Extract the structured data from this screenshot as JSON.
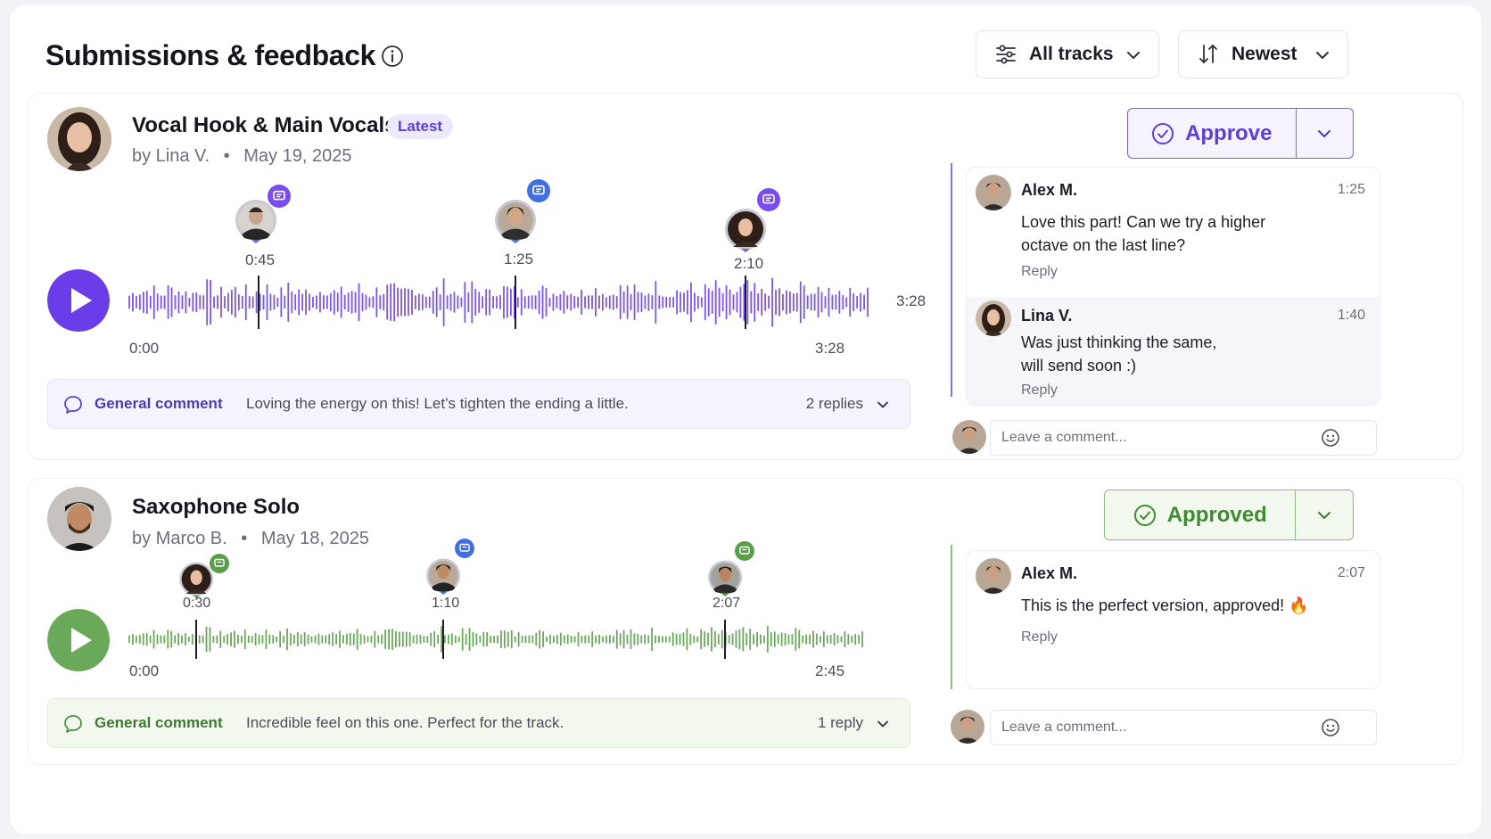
{
  "header": {
    "title": "Submissions & feedback",
    "filter_label": "All tracks",
    "sort_label": "Newest"
  },
  "colors": {
    "purple": "#6a3de8",
    "green": "#5a9e4b",
    "blue": "#3f6fe0"
  },
  "tracks": [
    {
      "title": "Vocal Hook & Main Vocals",
      "badge": "Latest",
      "artist": "by Lina V.",
      "date": "May 19, 2025",
      "start_time": "0:00",
      "end_time": "3:28",
      "duration": "3:28",
      "status_label": "Approve",
      "markers": [
        {
          "time": "0:45",
          "badge_color": "purple"
        },
        {
          "time": "1:25",
          "badge_color": "blue"
        },
        {
          "time": "2:10",
          "badge_color": "purple"
        }
      ],
      "general_comment": {
        "label": "General comment",
        "text": "Loving the energy on this! Let’s tighten the ending a little.",
        "replies": "2 replies"
      },
      "comments": [
        {
          "author": "Alex M.",
          "time": "1:25",
          "text": "Love this part! Can we try a higher octave on the last line?",
          "reply": "Reply"
        },
        {
          "author": "Lina V.",
          "time": "1:40",
          "text": "Was just thinking the same, will send soon :)",
          "reply": "Reply"
        }
      ],
      "input_placeholder": "Leave a comment..."
    },
    {
      "title": "Saxophone Solo",
      "artist": "by Marco B.",
      "date": "May 18, 2025",
      "start_time": "0:00",
      "end_time": "2:45",
      "status_label": "Approved",
      "markers": [
        {
          "time": "0:30",
          "badge_color": "green"
        },
        {
          "time": "1:10",
          "badge_color": "blue"
        },
        {
          "time": "2:07",
          "badge_color": "green"
        }
      ],
      "general_comment": {
        "label": "General comment",
        "text": "Incredible feel on this one. Perfect for the track.",
        "replies": "1 reply"
      },
      "comments": [
        {
          "author": "Alex M.",
          "time": "2:07",
          "text": "This is the perfect version, approved! 🔥",
          "reply": "Reply"
        }
      ],
      "input_placeholder": "Leave a comment..."
    }
  ]
}
